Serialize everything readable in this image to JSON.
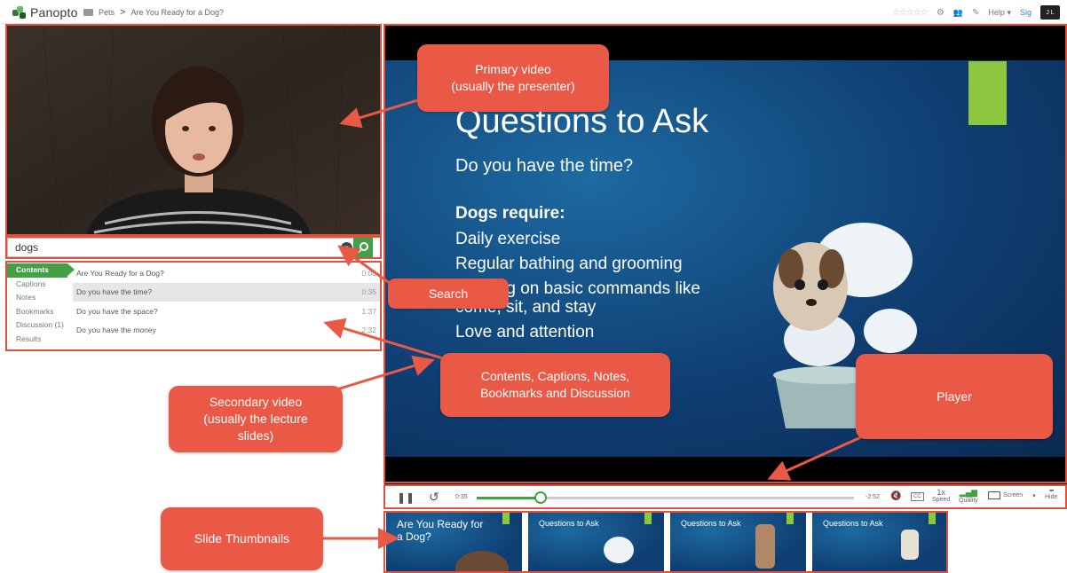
{
  "app": {
    "name": "Panopto"
  },
  "breadcrumb": {
    "folder": "Pets",
    "separator": ">",
    "session": "Are You Ready for a Dog?"
  },
  "toolbar": {
    "stars": "☆☆☆☆☆",
    "help": "Help",
    "help_caret": "▾",
    "signin": "Sig",
    "badge": "J L"
  },
  "search": {
    "value": "dogs"
  },
  "tabs": [
    "Contents",
    "Captions",
    "Notes",
    "Bookmarks",
    "Discussion (1)",
    "Results"
  ],
  "contents": [
    {
      "title": "Are You Ready for a Dog?",
      "time": "0:00"
    },
    {
      "title": "Do you have the time?",
      "time": "0:35"
    },
    {
      "title": "Do you have the space?",
      "time": "1:37"
    },
    {
      "title": "Do you have the money",
      "time": "2:32"
    }
  ],
  "slide": {
    "title": "Questions to Ask",
    "subtitle": "Do you have the time?",
    "heading": "Dogs require:",
    "bullets": [
      "Daily exercise",
      "Regular bathing and grooming",
      "Training on basic commands like",
      "come, sit, and stay",
      "Love and attention"
    ]
  },
  "controls": {
    "elapsed": "0:35",
    "remaining": "-2:52",
    "progress": 0.17,
    "speed_value": "1x",
    "speed_label": "Speed",
    "quality_label": "Quality",
    "screen_label": "Screen",
    "hide_label": "Hide",
    "cc": "CC"
  },
  "thumbnails": [
    {
      "title": "Are You Ready for a Dog?"
    },
    {
      "title": "Questions to Ask"
    },
    {
      "title": "Questions to Ask"
    },
    {
      "title": "Questions to Ask"
    }
  ],
  "callouts": {
    "primary": "Primary video\n(usually the presenter)",
    "search": "Search",
    "contents": "Contents, Captions, Notes,\nBookmarks and Discussion",
    "secondary": "Secondary video\n(usually the lecture\nslides)",
    "player": "Player",
    "thumbs": "Slide Thumbnails"
  },
  "colors": {
    "accent": "#43a047",
    "callout": "#ea5846",
    "outline": "#e0503f",
    "slide_green": "#8dc63f"
  }
}
